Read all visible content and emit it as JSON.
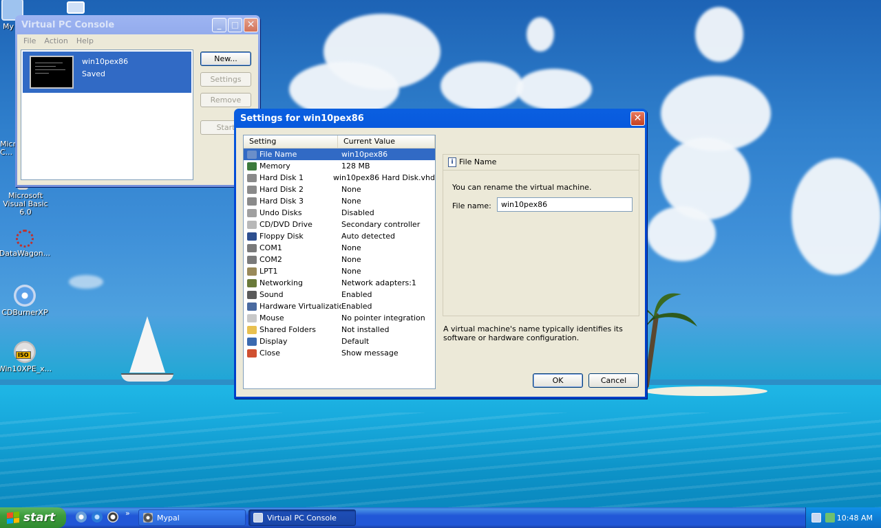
{
  "desktop": {
    "icons": [
      {
        "label": "My"
      },
      {
        "label": "Micro... C..."
      },
      {
        "label": "Microsoft Visual Basic 6.0"
      },
      {
        "label": "DataWagon..."
      },
      {
        "label": "CDBurnerXP"
      },
      {
        "label": "Win10XPE_x..."
      }
    ]
  },
  "console": {
    "title": "Virtual PC Console",
    "menu": [
      "File",
      "Action",
      "Help"
    ],
    "vm": {
      "name": "win10pex86",
      "state": "Saved"
    },
    "buttons": {
      "new": "New...",
      "settings": "Settings",
      "remove": "Remove",
      "start": "Start"
    }
  },
  "settings": {
    "title": "Settings for win10pex86",
    "columns": {
      "setting": "Setting",
      "value": "Current Value"
    },
    "rows": [
      {
        "name": "File Name",
        "value": "win10pex86",
        "icon": "document-icon",
        "color": "#6b8fc9",
        "selected": true
      },
      {
        "name": "Memory",
        "value": "128 MB",
        "icon": "memory-icon",
        "color": "#3c7a3c"
      },
      {
        "name": "Hard Disk 1",
        "value": "win10pex86 Hard Disk.vhd",
        "icon": "hard-disk-icon",
        "color": "#8a8a8a"
      },
      {
        "name": "Hard Disk 2",
        "value": "None",
        "icon": "hard-disk-icon",
        "color": "#8a8a8a"
      },
      {
        "name": "Hard Disk 3",
        "value": "None",
        "icon": "hard-disk-icon",
        "color": "#8a8a8a"
      },
      {
        "name": "Undo Disks",
        "value": "Disabled",
        "icon": "undo-disk-icon",
        "color": "#a0a0a0"
      },
      {
        "name": "CD/DVD Drive",
        "value": "Secondary controller",
        "icon": "cd-icon",
        "color": "#b8b8b8"
      },
      {
        "name": "Floppy Disk",
        "value": "Auto detected",
        "icon": "floppy-icon",
        "color": "#2e4f8f"
      },
      {
        "name": "COM1",
        "value": "None",
        "icon": "serial-port-icon",
        "color": "#7a7a7a"
      },
      {
        "name": "COM2",
        "value": "None",
        "icon": "serial-port-icon",
        "color": "#7a7a7a"
      },
      {
        "name": "LPT1",
        "value": "None",
        "icon": "parallel-port-icon",
        "color": "#9a8a5a"
      },
      {
        "name": "Networking",
        "value": "Network adapters:1",
        "icon": "network-icon",
        "color": "#6a7a3a"
      },
      {
        "name": "Sound",
        "value": "Enabled",
        "icon": "sound-icon",
        "color": "#5a5a5a"
      },
      {
        "name": "Hardware Virtualization",
        "value": "Enabled",
        "icon": "chip-icon",
        "color": "#4a6aa0"
      },
      {
        "name": "Mouse",
        "value": "No pointer integration",
        "icon": "mouse-icon",
        "color": "#c8c8c8"
      },
      {
        "name": "Shared Folders",
        "value": "Not installed",
        "icon": "folder-icon",
        "color": "#e8c050"
      },
      {
        "name": "Display",
        "value": "Default",
        "icon": "display-icon",
        "color": "#3a6ab0"
      },
      {
        "name": "Close",
        "value": "Show message",
        "icon": "power-icon",
        "color": "#d05030"
      }
    ],
    "detail": {
      "header": "File Name",
      "text": "You can rename the virtual machine.",
      "field_label": "File name:",
      "field_value": "win10pex86",
      "help": "A virtual machine's name typically identifies its software or hardware configuration."
    },
    "ok": "OK",
    "cancel": "Cancel"
  },
  "taskbar": {
    "start": "start",
    "items": [
      {
        "label": "Mypal"
      },
      {
        "label": "Virtual PC Console"
      }
    ],
    "chevron": "»",
    "clock": "10:48 AM"
  }
}
